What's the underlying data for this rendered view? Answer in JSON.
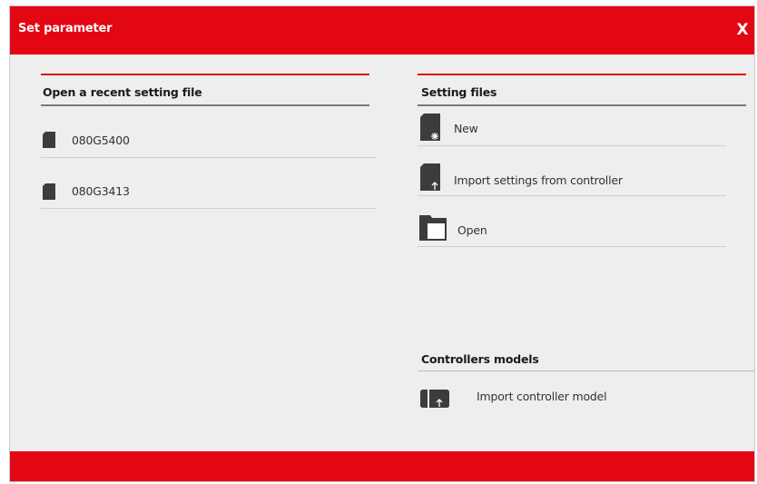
{
  "dialog": {
    "title": "Set parameter",
    "close_label": "X"
  },
  "recent": {
    "heading": "Open a recent setting file",
    "items": [
      {
        "label": "080G5400",
        "icon": "file-icon"
      },
      {
        "label": "080G3413",
        "icon": "file-icon"
      }
    ]
  },
  "setting_files": {
    "heading": "Setting files",
    "items": [
      {
        "label": "New",
        "icon": "new-file-icon"
      },
      {
        "label": "Import settings from controller",
        "icon": "import-file-icon"
      },
      {
        "label": "Open",
        "icon": "folder-icon"
      }
    ]
  },
  "controller_models": {
    "heading": "Controllers models",
    "items": [
      {
        "label": "Import controller model",
        "icon": "controller-import-icon"
      }
    ]
  },
  "colors": {
    "accent": "#e30613",
    "background": "#eeeeee",
    "icon": "#3c3c3c"
  }
}
